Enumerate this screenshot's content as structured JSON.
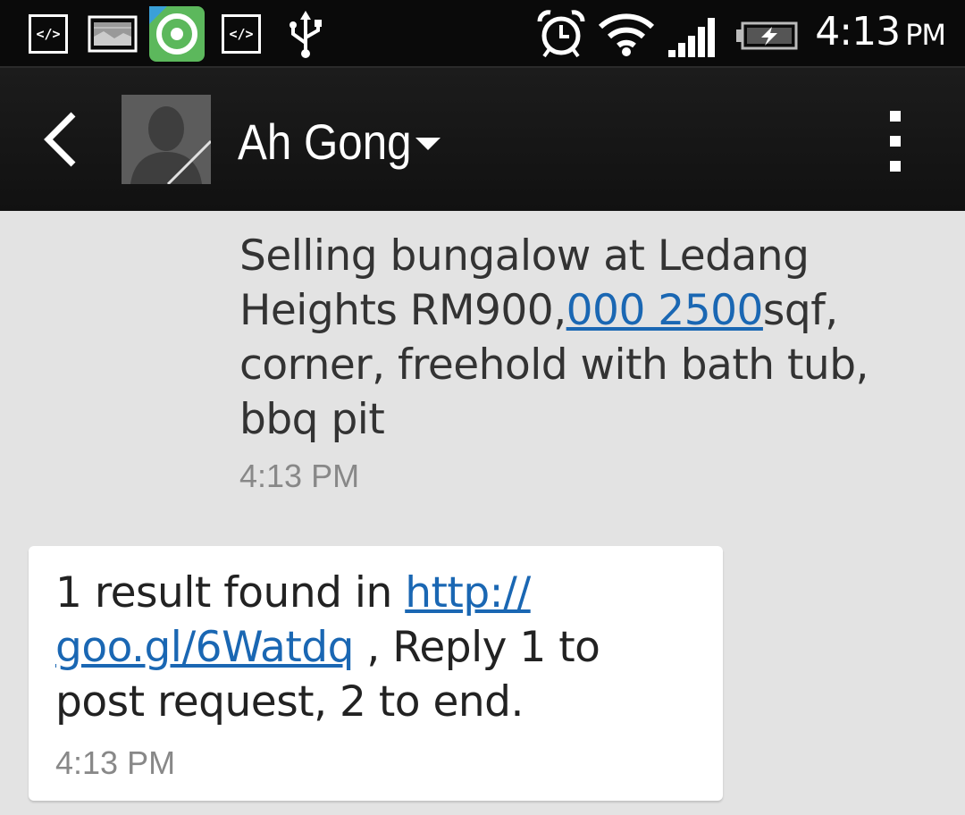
{
  "status_bar": {
    "time": "4:13",
    "ampm": "PM",
    "icons": [
      "code-icon",
      "gallery-icon",
      "app-pro-icon",
      "code-icon",
      "usb-icon",
      "alarm-icon",
      "wifi-icon",
      "signal-icon",
      "battery-charging-icon"
    ]
  },
  "action_bar": {
    "contact_name": "Ah Gong",
    "icons": [
      "back-icon",
      "avatar",
      "dropdown-arrow-icon",
      "overflow-menu-icon"
    ]
  },
  "messages": [
    {
      "direction": "sent",
      "text_before_link": "Selling bungalow at Ledang Heights RM900,",
      "link": "000 2500",
      "text_after_link": "sqf, corner, freehold with bath tub, bbq pit",
      "time": "4:13 PM"
    },
    {
      "direction": "received",
      "text_before_link": "1 result found in ",
      "link_part1": "http://",
      "link_part2": "goo.gl/6Watdq",
      "text_after_link": " , Reply 1 to post request, 2 to end.",
      "time": "4:13 PM"
    }
  ],
  "colors": {
    "link": "#1a67b3",
    "background": "#e3e3e3",
    "app_pro_green": "#5cb85c"
  }
}
